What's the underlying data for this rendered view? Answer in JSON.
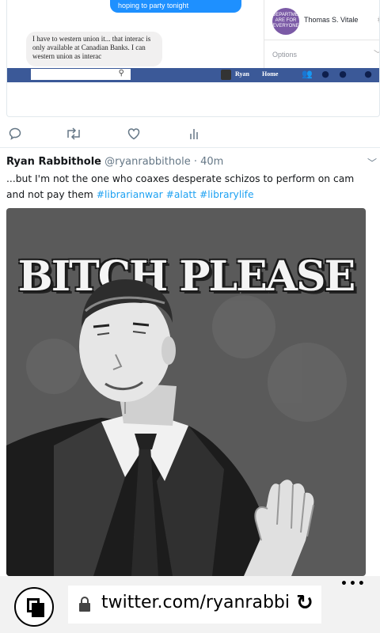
{
  "embed": {
    "blue_bubble": "hoping to party tonight",
    "grey_bubble": "I have to western union it... that interac is only available at Canadian Banks. I can western union as interac",
    "fb_user": "Ryan",
    "fb_home": "Home",
    "contact_name": "Thomas S. Vitale",
    "contact_avatar_text": "DEPARTMENT ARE FOR EVERYONE",
    "options_label": "Options"
  },
  "actions": {
    "reply_icon": "reply-icon",
    "retweet_icon": "retweet-icon",
    "like_icon": "heart-icon",
    "analytics_icon": "analytics-icon"
  },
  "tweet": {
    "display_name": "Ryan Rabbithole",
    "handle": "@ryanrabbithole",
    "time": "· 40m",
    "text": "...but I'm not the one who coaxes desperate schizos to perform on cam and not pay them ",
    "hashtags": [
      "#librarianwar",
      "#alatt",
      "#librarylife"
    ]
  },
  "meme": {
    "caption": "BITCH PLEASE",
    "background_color": "#5a5a5a"
  },
  "browser": {
    "url": "twitter.com/ryanrabbi",
    "more": "•••"
  }
}
